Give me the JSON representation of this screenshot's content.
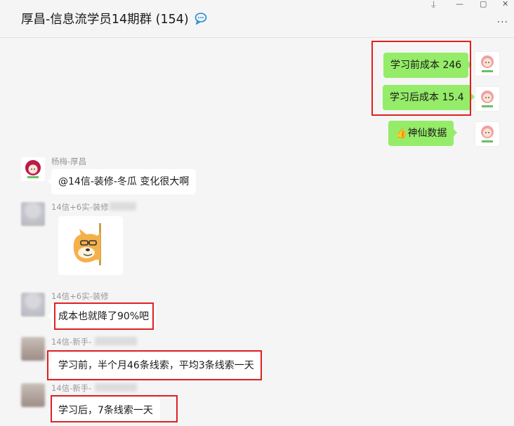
{
  "header": {
    "title": "厚昌-信息流学员14期群 (154)",
    "win_pin": "⍊",
    "win_minimize": "—",
    "win_maximize": "▢",
    "win_close": "✕",
    "more": "···"
  },
  "messages": {
    "m1_text": "学习前成本 246",
    "m2_text": "学习后成本 15.4",
    "m3_text": "神仙数据",
    "m3_emoji": "👍",
    "m4_sender": "杨梅-厚昌",
    "m4_text": "@14信-装修-冬瓜 变化很大啊",
    "m5_sender": "14信+6实-装修",
    "m6_sender": "14信+6实-装修",
    "m6_text": "成本也就降了90%吧",
    "m7_sender": "14信-新手-",
    "m7_text": "学习前，半个月46条线索，平均3条线索一天",
    "m8_sender": "14信-新手-",
    "m8_text": "学习后，7条线索一天"
  },
  "colors": {
    "accent_green": "#95ec69",
    "highlight_red": "#e02020",
    "background": "#f5f5f5"
  }
}
